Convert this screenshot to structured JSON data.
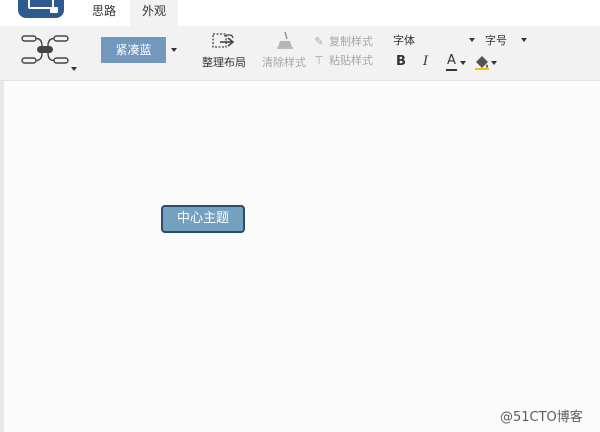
{
  "tabs": [
    {
      "label": "思路",
      "active": false
    },
    {
      "label": "外观",
      "active": true
    }
  ],
  "toolbar": {
    "theme_label": "紧凑蓝",
    "layout_label": "整理布局",
    "clear_style_label": "清除样式",
    "copy_style_label": "复制样式",
    "paste_style_label": "粘贴样式",
    "font_label": "字体",
    "size_label": "字号",
    "bold_label": "B",
    "italic_label": "I",
    "font_color_label": "A"
  },
  "canvas": {
    "central_topic": "中心主题"
  },
  "watermark": "@51CTO博客",
  "colors": {
    "toolbar_bg": "#f2f2f2",
    "theme_button": "#7398be",
    "node_fill": "#73a1bf",
    "node_border": "#2b4d6b",
    "logo": "#2e5a8f"
  }
}
